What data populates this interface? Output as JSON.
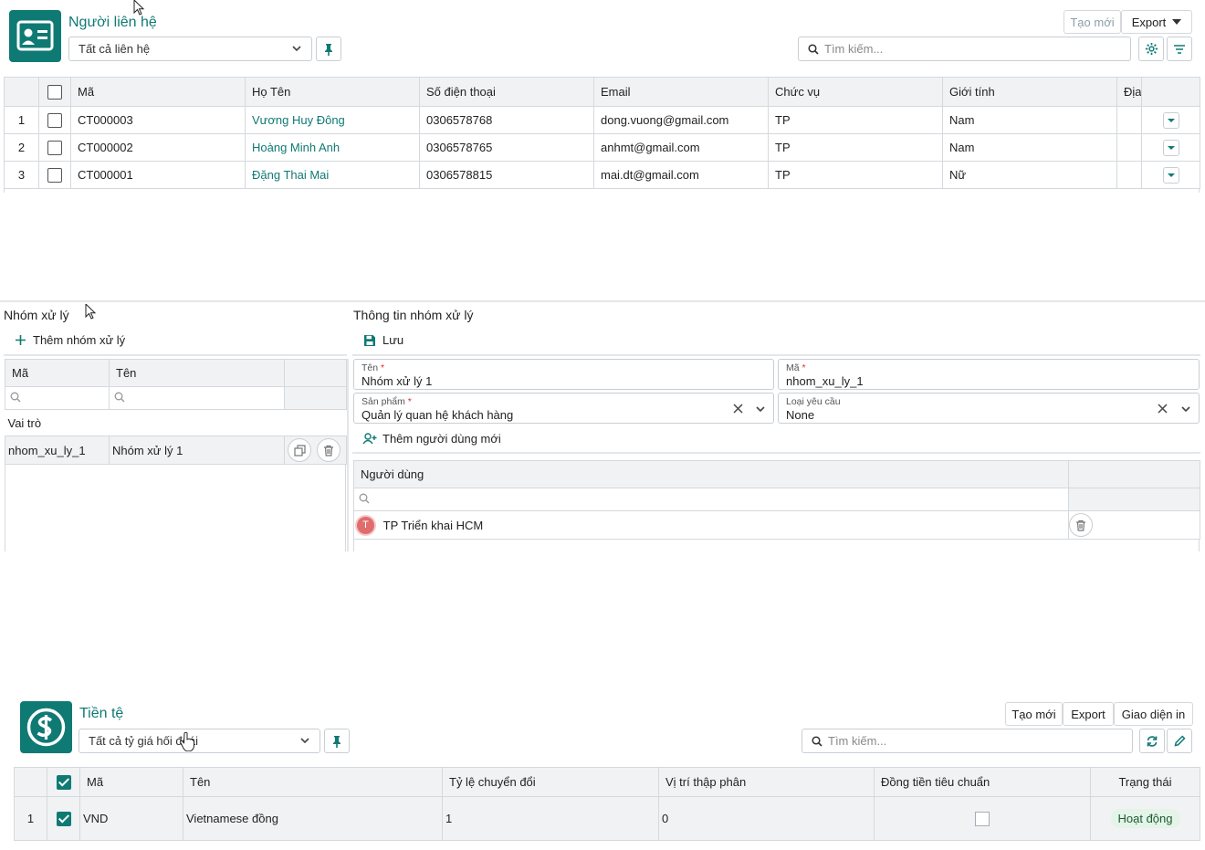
{
  "contacts": {
    "title": "Người liên hệ",
    "filter_value": "Tất cả liên hệ",
    "new_label": "Tạo mới",
    "export_label": "Export",
    "search_placeholder": "Tìm kiếm...",
    "columns": [
      "Mã",
      "Họ Tên",
      "Số điện thoại",
      "Email",
      "Chức vụ",
      "Giới tính",
      "Địa"
    ],
    "rows": [
      {
        "index": "1",
        "code": "CT000003",
        "name": "Vương Huy Đông",
        "phone": "0306578768",
        "email": "dong.vuong@gmail.com",
        "position": "TP",
        "gender": "Nam"
      },
      {
        "index": "2",
        "code": "CT000002",
        "name": "Hoàng Minh Anh",
        "phone": "0306578765",
        "email": "anhmt@gmail.com",
        "position": "TP",
        "gender": "Nam"
      },
      {
        "index": "3",
        "code": "CT000001",
        "name": "Đặng Thai Mai",
        "phone": "0306578815",
        "email": "mai.dt@gmail.com",
        "position": "TP",
        "gender": "Nữ"
      }
    ]
  },
  "groups": {
    "title": "Nhóm xử lý",
    "add_label": "Thêm nhóm xử lý",
    "columns": [
      "Mã",
      "Tên"
    ],
    "group_header": "Vai trò",
    "rows": [
      {
        "code": "nhom_xu_ly_1",
        "name": "Nhóm xử lý 1"
      }
    ]
  },
  "group_info": {
    "title": "Thông tin nhóm xử lý",
    "save_label": "Lưu",
    "name_label": "Tên",
    "name_value": "Nhóm xử lý 1",
    "code_label": "Mã",
    "code_value": "nhom_xu_ly_1",
    "product_label": "Sản phẩm",
    "product_value": "Quản lý quan hệ khách hàng",
    "request_type_label": "Loại yêu cầu",
    "request_type_value": "None",
    "add_user_label": "Thêm người dùng mới",
    "users_column": "Người dùng",
    "users": [
      {
        "avatar_letter": "T",
        "name": "TP Triển khai HCM"
      }
    ]
  },
  "currency": {
    "title": "Tiền tệ",
    "filter_value": "Tất cả tỷ giá hối đoái",
    "new_label": "Tạo mới",
    "export_label": "Export",
    "print_label": "Giao diện in",
    "search_placeholder": "Tìm kiếm...",
    "columns": [
      "Mã",
      "Tên",
      "Tỷ lệ chuyển đổi",
      "Vị trí thập phân",
      "Đồng tiền tiêu chuẩn",
      "Trạng thái"
    ],
    "rows": [
      {
        "index": "1",
        "code": "VND",
        "name": "Vietnamese đồng",
        "rate": "1",
        "decimals": "0",
        "status": "Hoạt động"
      }
    ]
  },
  "colors": {
    "accent": "#0f7a74",
    "required": "#d9342b",
    "avatar": "#e06c6c"
  }
}
